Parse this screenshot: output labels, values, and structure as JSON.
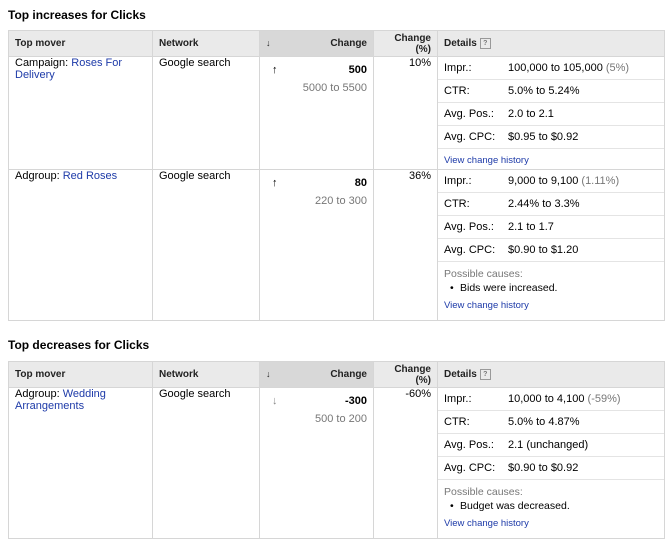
{
  "sections": [
    {
      "title": "Top increases for Clicks",
      "headers": {
        "mover": "Top mover",
        "network": "Network",
        "change": "Change",
        "change_pct": "Change (%)",
        "details": "Details"
      },
      "rows": [
        {
          "mover_prefix": "Campaign: ",
          "mover_link": "Roses For Delivery",
          "network": "Google search",
          "change": "500",
          "change_range": "5000 to 5500",
          "change_pct": "10%",
          "details": [
            {
              "label": "Impr.:",
              "value": "100,000 to 105,000",
              "extra": "(5%)"
            },
            {
              "label": "CTR:",
              "value": "5.0% to 5.24%",
              "extra": ""
            },
            {
              "label": "Avg. Pos.:",
              "value": "2.0 to 2.1",
              "extra": ""
            },
            {
              "label": "Avg. CPC:",
              "value": "$0.95 to $0.92",
              "extra": ""
            }
          ],
          "history": "View change history"
        },
        {
          "mover_prefix": "Adgroup: ",
          "mover_link": "Red Roses",
          "network": "Google search",
          "change": "80",
          "change_range": "220 to 300",
          "change_pct": "36%",
          "details": [
            {
              "label": "Impr.:",
              "value": "9,000 to 9,100",
              "extra": "(1.11%)"
            },
            {
              "label": "CTR:",
              "value": "2.44% to 3.3%",
              "extra": ""
            },
            {
              "label": "Avg. Pos.:",
              "value": "2.1 to 1.7",
              "extra": ""
            },
            {
              "label": "Avg. CPC:",
              "value": "$0.90 to $1.20",
              "extra": ""
            }
          ],
          "causes_title": "Possible causes:",
          "causes": [
            "Bids were increased."
          ],
          "history": "View change history"
        }
      ]
    },
    {
      "title": "Top decreases for Clicks",
      "headers": {
        "mover": "Top mover",
        "network": "Network",
        "change": "Change",
        "change_pct": "Change (%)",
        "details": "Details"
      },
      "rows": [
        {
          "mover_prefix": "Adgroup: ",
          "mover_link": "Wedding Arrangements",
          "network": "Google search",
          "change": "-300",
          "change_range": "500 to 200",
          "change_pct": "-60%",
          "details": [
            {
              "label": "Impr.:",
              "value": "10,000 to 4,100",
              "extra": "(-59%)"
            },
            {
              "label": "CTR:",
              "value": "5.0% to 4.87%",
              "extra": ""
            },
            {
              "label": "Avg. Pos.:",
              "value": "2.1 (unchanged)",
              "extra": ""
            },
            {
              "label": "Avg. CPC:",
              "value": "$0.90 to $0.92",
              "extra": ""
            }
          ],
          "causes_title": "Possible causes:",
          "causes": [
            "Budget was decreased."
          ],
          "history": "View change history"
        }
      ]
    }
  ],
  "icons": {
    "sort": "sort-down-arrow-icon",
    "up": "arrow-up-icon",
    "down": "arrow-down-icon",
    "help": "help-icon"
  }
}
